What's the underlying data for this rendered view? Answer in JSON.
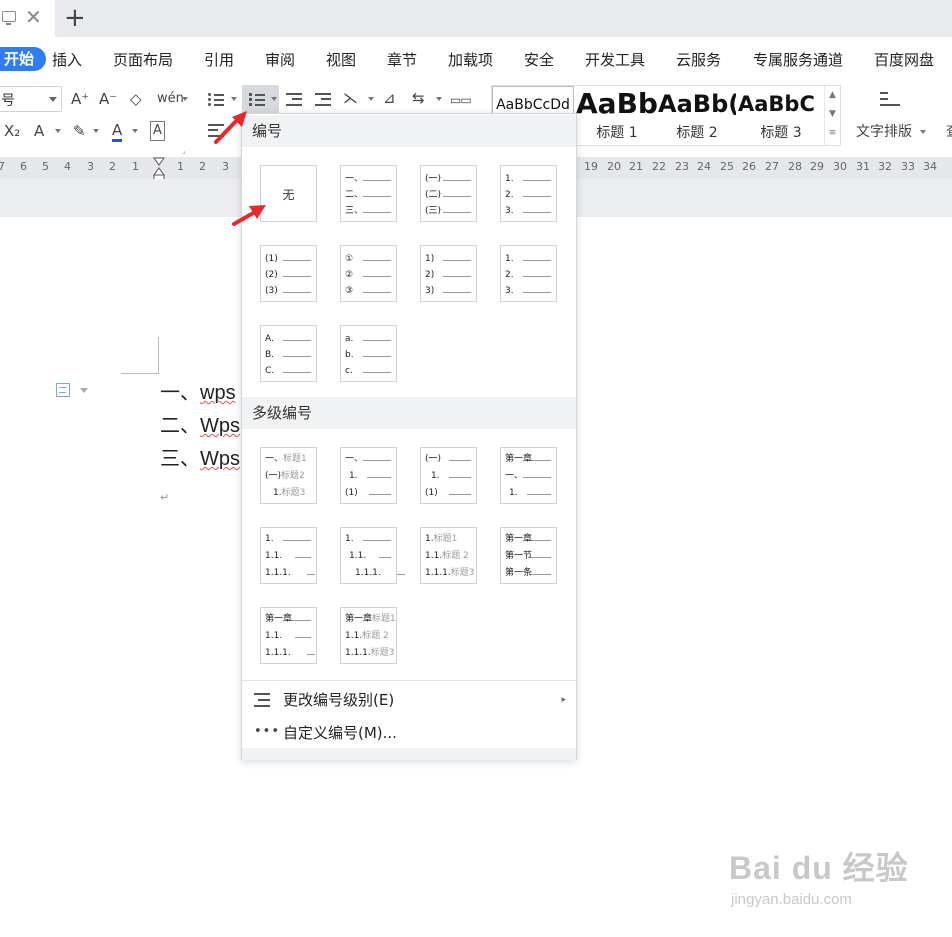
{
  "colors": {
    "accent": "#2f7cf6",
    "annotation_arrow": "#e8262c",
    "ruler": "#e5e7ea",
    "section_header": "#f1f2f4"
  },
  "tab_strip": {
    "close_glyph": "✕",
    "new_tab_glyph": "+"
  },
  "menubar": {
    "items": [
      "开始",
      "插入",
      "页面布局",
      "引用",
      "审阅",
      "视图",
      "章节",
      "加载项",
      "安全",
      "开发工具",
      "云服务",
      "专属服务通道",
      "百度网盘"
    ],
    "active_index": 0
  },
  "ribbon": {
    "font_size_value": "号",
    "buttons": {
      "grow_font": "A⁺",
      "shrink_font": "A⁻",
      "clear_format": "◇",
      "pinyin": "wén",
      "subscript": "X₂",
      "text_effect": "A",
      "highlight": "✎",
      "font_color": "A",
      "char_border": "A"
    },
    "styles": [
      {
        "sample": "AaBbCcDd",
        "name": ""
      },
      {
        "sample": "AaBb",
        "name": "标题 1"
      },
      {
        "sample": "AaBb(",
        "name": "标题 2"
      },
      {
        "sample": "AaBbC",
        "name": "标题 3"
      }
    ],
    "text_layout_label": "文字排版",
    "cut_label": "查"
  },
  "ruler": {
    "left_numbers": [
      "7",
      "6",
      "5",
      "4",
      "3",
      "2",
      "1"
    ],
    "right_numbers": [
      "1",
      "2",
      "3"
    ],
    "far_numbers": [
      "19",
      "20",
      "21",
      "22",
      "23",
      "24",
      "25",
      "26",
      "27",
      "28",
      "29",
      "30",
      "31",
      "32",
      "33",
      "34"
    ]
  },
  "document": {
    "lines": [
      {
        "prefix": "一、",
        "word": "wps"
      },
      {
        "prefix": "二、",
        "word": "Wps"
      },
      {
        "prefix": "三、",
        "word": "Wps"
      }
    ],
    "pilcrow": "↵"
  },
  "numbering_panel": {
    "section_single": "编号",
    "section_multi": "多级编号",
    "none_label": "无",
    "single_tiles": [
      [
        "一、",
        "二、",
        "三、"
      ],
      [
        "(一)",
        "(二)",
        "(三)"
      ],
      [
        "1.",
        "2.",
        "3."
      ],
      [
        "(1)",
        "(2)",
        "(3)"
      ],
      [
        "①",
        "②",
        "③"
      ],
      [
        "1)",
        "2)",
        "3)"
      ],
      [
        "1.",
        "2.",
        "3."
      ],
      [
        "A.",
        "B.",
        "C."
      ],
      [
        "a.",
        "b.",
        "c."
      ]
    ],
    "multi_tiles": [
      [
        [
          "一、",
          "标题1"
        ],
        [
          "(一)",
          "标题2"
        ],
        [
          "1.",
          "标题3"
        ]
      ],
      [
        [
          "一、",
          ""
        ],
        [
          "1.",
          ""
        ],
        [
          "(1)",
          ""
        ]
      ],
      [
        [
          "(一)",
          ""
        ],
        [
          "1.",
          ""
        ],
        [
          "(1)",
          ""
        ]
      ],
      [
        [
          "第一章",
          ""
        ],
        [
          "一、",
          ""
        ],
        [
          "1.",
          ""
        ]
      ],
      [
        [
          "1.",
          ""
        ],
        [
          "1.1.",
          ""
        ],
        [
          "1.1.1.",
          ""
        ]
      ],
      [
        [
          "1.",
          ""
        ],
        [
          "1.1.",
          ""
        ],
        [
          "1.1.1.",
          ""
        ]
      ],
      [
        [
          "1.",
          "标题1"
        ],
        [
          "1.1.",
          "标题 2"
        ],
        [
          "1.1.1.",
          "标题3"
        ]
      ],
      [
        [
          "第一章",
          ""
        ],
        [
          "第一节",
          ""
        ],
        [
          "第一条",
          ""
        ]
      ],
      [
        [
          "第一章",
          ""
        ],
        [
          "1.1.",
          ""
        ],
        [
          "1.1.1.",
          ""
        ]
      ],
      [
        [
          "第一章",
          "标题1"
        ],
        [
          "1.1.",
          "标题 2"
        ],
        [
          "1.1.1.",
          "标题3"
        ]
      ]
    ],
    "change_level_label": "更改编号级别(E)",
    "custom_label": "自定义编号(M)...",
    "chevron": "▸"
  },
  "watermark": {
    "main": "Bai du 经验",
    "sub": "jingyan.baidu.com"
  }
}
